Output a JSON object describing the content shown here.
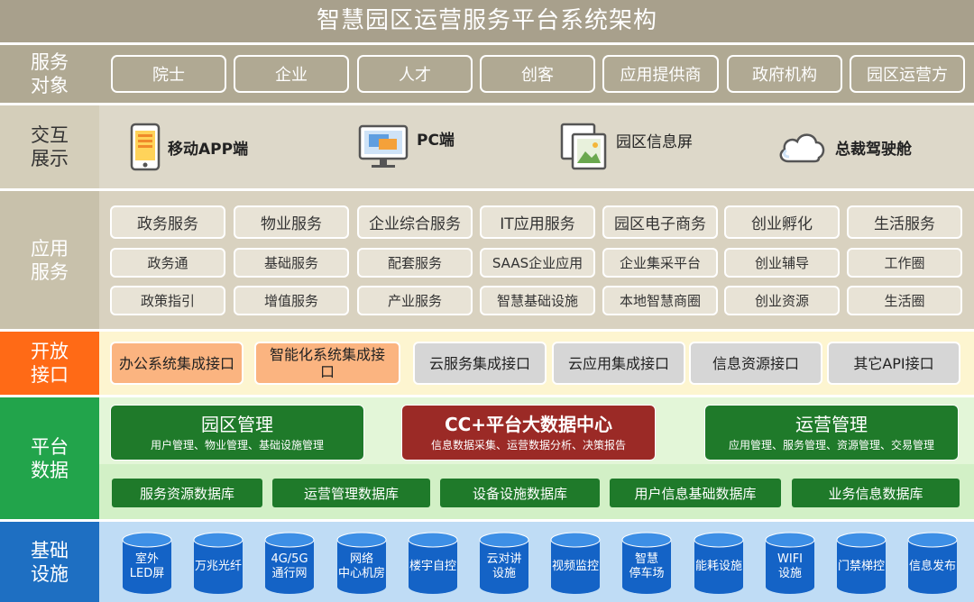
{
  "title": "智慧园区运营服务平台系统架构",
  "services": {
    "label": "服务\n对象",
    "items": [
      "院士",
      "企业",
      "人才",
      "创客",
      "应用提供商",
      "政府机构",
      "园区运营方"
    ]
  },
  "interaction": {
    "label": "交互\n展示",
    "items": [
      {
        "label": "移动APP端",
        "icon": "mobile-phone-icon"
      },
      {
        "label": "PC端",
        "icon": "desktop-monitor-icon"
      },
      {
        "label": "园区信息屏",
        "icon": "picture-screen-icon"
      },
      {
        "label": "总裁驾驶舱",
        "icon": "cloud-icon"
      }
    ]
  },
  "apps": {
    "label": "应用\n服务",
    "row1": [
      "政务服务",
      "物业服务",
      "企业综合服务",
      "IT应用服务",
      "园区电子商务",
      "创业孵化",
      "生活服务"
    ],
    "row2": [
      "政务通",
      "基础服务",
      "配套服务",
      "SAAS企业应用",
      "企业集采平台",
      "创业辅导",
      "工作圈"
    ],
    "row3": [
      "政策指引",
      "增值服务",
      "产业服务",
      "智慧基础设施",
      "本地智慧商圈",
      "创业资源",
      "生活圈"
    ]
  },
  "open_api": {
    "label": "开放\n接口",
    "items": [
      "办公系统集成接口",
      "智能化系统集成接口",
      "云服务集成接口",
      "云应用集成接口",
      "信息资源接口",
      "其它API接口"
    ]
  },
  "platform": {
    "label": "平台\n数据",
    "boxes": [
      {
        "title": "园区管理",
        "sub": "用户管理、物业管理、基础设施管理"
      },
      {
        "title": "CC+平台大数据中心",
        "sub": "信息数据采集、运营数据分析、决策报告"
      },
      {
        "title": "运营管理",
        "sub": "应用管理、服务管理、资源管理、交易管理"
      }
    ],
    "databases": [
      "服务资源数据库",
      "运营管理数据库",
      "设备设施数据库",
      "用户信息基础数据库",
      "业务信息数据库"
    ]
  },
  "infra": {
    "label": "基础\n设施",
    "items": [
      "室外\nLED屏",
      "万兆光纤",
      "4G/5G\n通行网",
      "网络\n中心机房",
      "楼宇自控",
      "云对讲\n设施",
      "视频监控",
      "智慧\n停车场",
      "能耗设施",
      "WIFI\n设施",
      "门禁梯控",
      "信息发布"
    ]
  },
  "colors": {
    "orange": "#ff6a16",
    "green": "#22a44b",
    "dark_green": "#1f7a2a",
    "dark_red": "#9b2a26",
    "blue": "#1e6fc2"
  }
}
